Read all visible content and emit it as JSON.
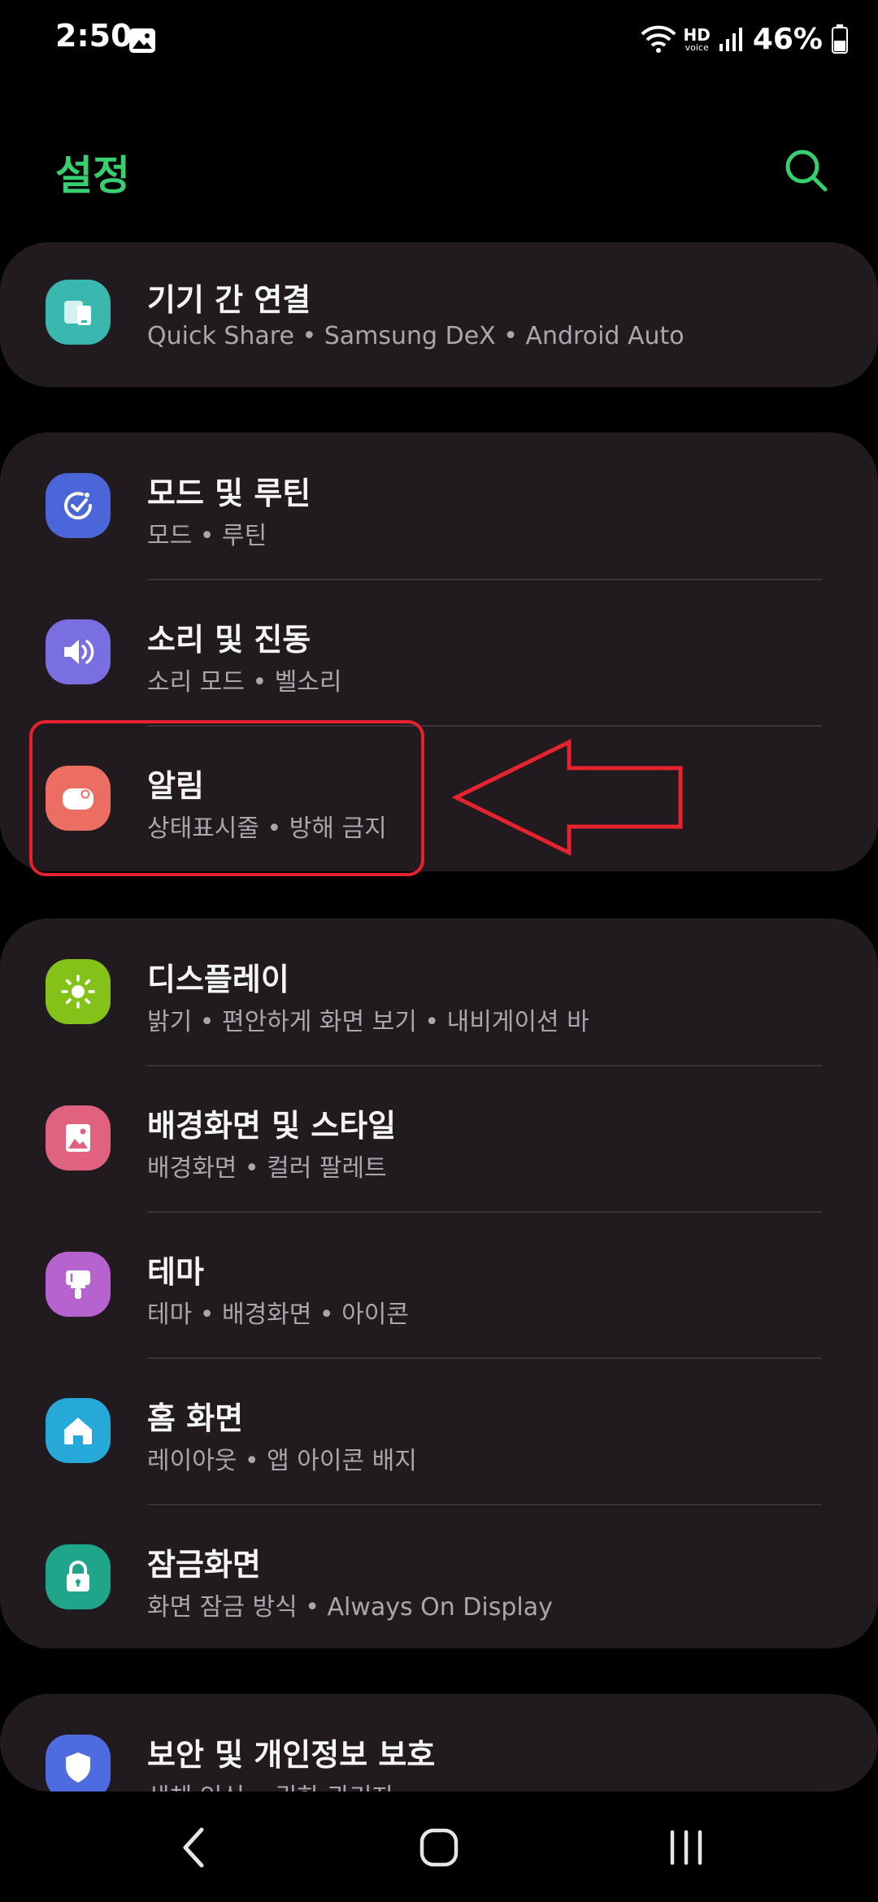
{
  "status_bar": {
    "time": "2:50",
    "hd_label": "HD",
    "voice_label": "voice",
    "battery_percent": "46%",
    "icons": [
      "gallery-icon",
      "wifi-icon",
      "hd-voice-icon",
      "signal-icon",
      "battery-icon"
    ]
  },
  "header": {
    "title": "설정",
    "search_icon": "search-icon"
  },
  "colors": {
    "title_green": "#37d06f",
    "card_bg": "#211b20",
    "highlight_red": "#e5222e"
  },
  "sections": [
    {
      "items": [
        {
          "title": "기기 간 연결",
          "subtitle": "Quick Share  •  Samsung DeX  •  Android Auto",
          "icon": "connected-devices-icon",
          "icon_color": "#3ab8b0"
        }
      ]
    },
    {
      "items": [
        {
          "title": "모드 및 루틴",
          "subtitle": "모드  •  루틴",
          "icon": "modes-routines-icon",
          "icon_color": "#4b66d8"
        },
        {
          "title": "소리 및 진동",
          "subtitle": "소리 모드  •  벨소리",
          "icon": "sound-icon",
          "icon_color": "#7a6fe0"
        },
        {
          "title": "알림",
          "subtitle": "상태표시줄  •  방해 금지",
          "icon": "notification-icon",
          "icon_color": "#ec6e62"
        }
      ]
    },
    {
      "items": [
        {
          "title": "디스플레이",
          "subtitle": "밝기  •  편안하게 화면 보기  •  내비게이션 바",
          "icon": "display-icon",
          "icon_color": "#84c21a"
        },
        {
          "title": "배경화면 및 스타일",
          "subtitle": "배경화면  •  컬러 팔레트",
          "icon": "wallpaper-icon",
          "icon_color": "#e0627f"
        },
        {
          "title": "테마",
          "subtitle": "테마  •  배경화면  •  아이콘",
          "icon": "theme-icon",
          "icon_color": "#b663cf"
        },
        {
          "title": "홈 화면",
          "subtitle": "레이아웃  •  앱 아이콘 배지",
          "icon": "home-icon",
          "icon_color": "#26a8d8"
        },
        {
          "title": "잠금화면",
          "subtitle": "화면 잠금 방식  •  Always On Display",
          "icon": "lock-icon",
          "icon_color": "#1fa58a"
        }
      ]
    },
    {
      "items": [
        {
          "title": "보안 및 개인정보 보호",
          "subtitle": "생체 인식  •  권한 관리자",
          "icon": "shield-icon",
          "icon_color": "#4f6be0"
        }
      ]
    }
  ],
  "annotation": {
    "highlighted_item": "알림",
    "arrow_direction": "left"
  },
  "nav_bar": {
    "buttons": [
      "back-icon",
      "home-nav-icon",
      "recents-icon"
    ]
  }
}
